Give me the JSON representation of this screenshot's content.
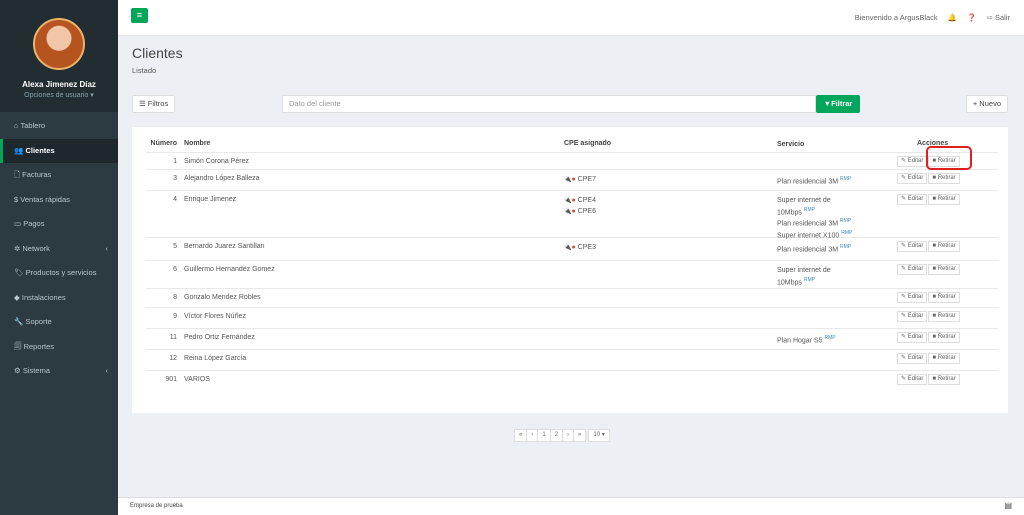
{
  "sidebar": {
    "user_name": "Alexa Jimenez Díaz",
    "user_options": "Opciones de usuario ▾",
    "menu": [
      {
        "label": "Tablero",
        "icon": "⌂"
      },
      {
        "label": "Clientes",
        "icon": "👥"
      },
      {
        "label": "Facturas",
        "icon": "🗋"
      },
      {
        "label": "Ventas rápidas",
        "icon": "$"
      },
      {
        "label": "Pagos",
        "icon": "▭"
      },
      {
        "label": "Network",
        "icon": "✲"
      },
      {
        "label": "Productos y servicios",
        "icon": "🏷"
      },
      {
        "label": "Instalaciones",
        "icon": "◆"
      },
      {
        "label": "Soporte",
        "icon": "🔧"
      },
      {
        "label": "Reportes",
        "icon": "🗐"
      },
      {
        "label": "Sistema",
        "icon": "⚙"
      }
    ]
  },
  "topbar": {
    "menu_icon": "≡",
    "welcome": "Bienvenido a ArgusBlack",
    "bell_icon": "🔔",
    "help_icon": "❓",
    "logout": "⇨ Salir"
  },
  "page": {
    "title": "Clientes",
    "subtitle": "Listado"
  },
  "toolbar": {
    "filters": "☰ Filtros",
    "search_placeholder": "Dato del cliente",
    "filter_button": "▼Filtrar",
    "new_button": "+ Nuevo"
  },
  "table": {
    "headers": {
      "num": "Número",
      "name": "Nombre",
      "cpe": "CPE asignado",
      "service": "Servicio",
      "actions": "Acciones"
    },
    "rows": [
      {
        "num": "1",
        "name": "Simón Corona Pérez",
        "cpe": [],
        "services": []
      },
      {
        "num": "3",
        "name": "Alejandro López Balleza",
        "cpe": [
          "CPE7"
        ],
        "services": [
          "Plan residencial 3M"
        ]
      },
      {
        "num": "4",
        "name": "Enrique Jimenez",
        "cpe": [
          "CPE4",
          "CPE6"
        ],
        "services": [
          "Super internet de",
          "10Mbps",
          "Plan residencial 3M",
          "Super internet X100"
        ]
      },
      {
        "num": "5",
        "name": "Bernardo Juarez Santillan",
        "cpe": [
          "CPE3"
        ],
        "services": [
          "Plan residencial 3M"
        ]
      },
      {
        "num": "6",
        "name": "Guillermo Hernandez Gomez",
        "cpe": [],
        "services": [
          "Super internet de",
          "10Mbps"
        ]
      },
      {
        "num": "8",
        "name": "Gonzalo Mendez Robles",
        "cpe": [],
        "services": []
      },
      {
        "num": "9",
        "name": "Víctor Flores Núñez",
        "cpe": [],
        "services": []
      },
      {
        "num": "11",
        "name": "Pedro Ortiz Fernández",
        "cpe": [],
        "services": [
          "Plan Hogar S5"
        ]
      },
      {
        "num": "12",
        "name": "Reina López García",
        "cpe": [],
        "services": []
      },
      {
        "num": "901",
        "name": "VARIOS",
        "cpe": [],
        "services": []
      }
    ],
    "edit_label": "Editar",
    "retire_label": "Retirar",
    "rmp": "RMP"
  },
  "pager": {
    "first": "«",
    "prev": "‹",
    "pages": [
      "1",
      "2"
    ],
    "next": "›",
    "last": "»",
    "per_page": "10 ▾"
  },
  "footer": {
    "company": "Empresa de prueba",
    "icon": "▤"
  }
}
